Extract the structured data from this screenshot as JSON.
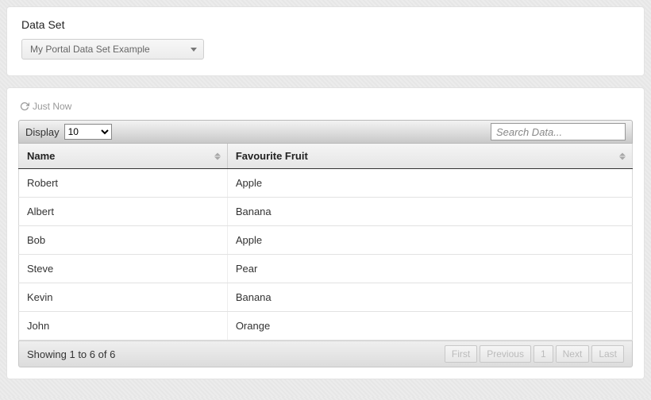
{
  "top": {
    "title": "Data Set",
    "selected": "My Portal Data Set Example"
  },
  "refresh": {
    "text": "Just Now"
  },
  "toolbar": {
    "display_label": "Display",
    "display_value": "10",
    "search_placeholder": "Search Data..."
  },
  "table": {
    "columns": [
      "Name",
      "Favourite Fruit"
    ],
    "rows": [
      {
        "name": "Robert",
        "fruit": "Apple"
      },
      {
        "name": "Albert",
        "fruit": "Banana"
      },
      {
        "name": "Bob",
        "fruit": "Apple"
      },
      {
        "name": "Steve",
        "fruit": "Pear"
      },
      {
        "name": "Kevin",
        "fruit": "Banana"
      },
      {
        "name": "John",
        "fruit": "Orange"
      }
    ]
  },
  "footer": {
    "summary": "Showing 1 to 6 of 6",
    "first": "First",
    "prev": "Previous",
    "page": "1",
    "next": "Next",
    "last": "Last"
  }
}
